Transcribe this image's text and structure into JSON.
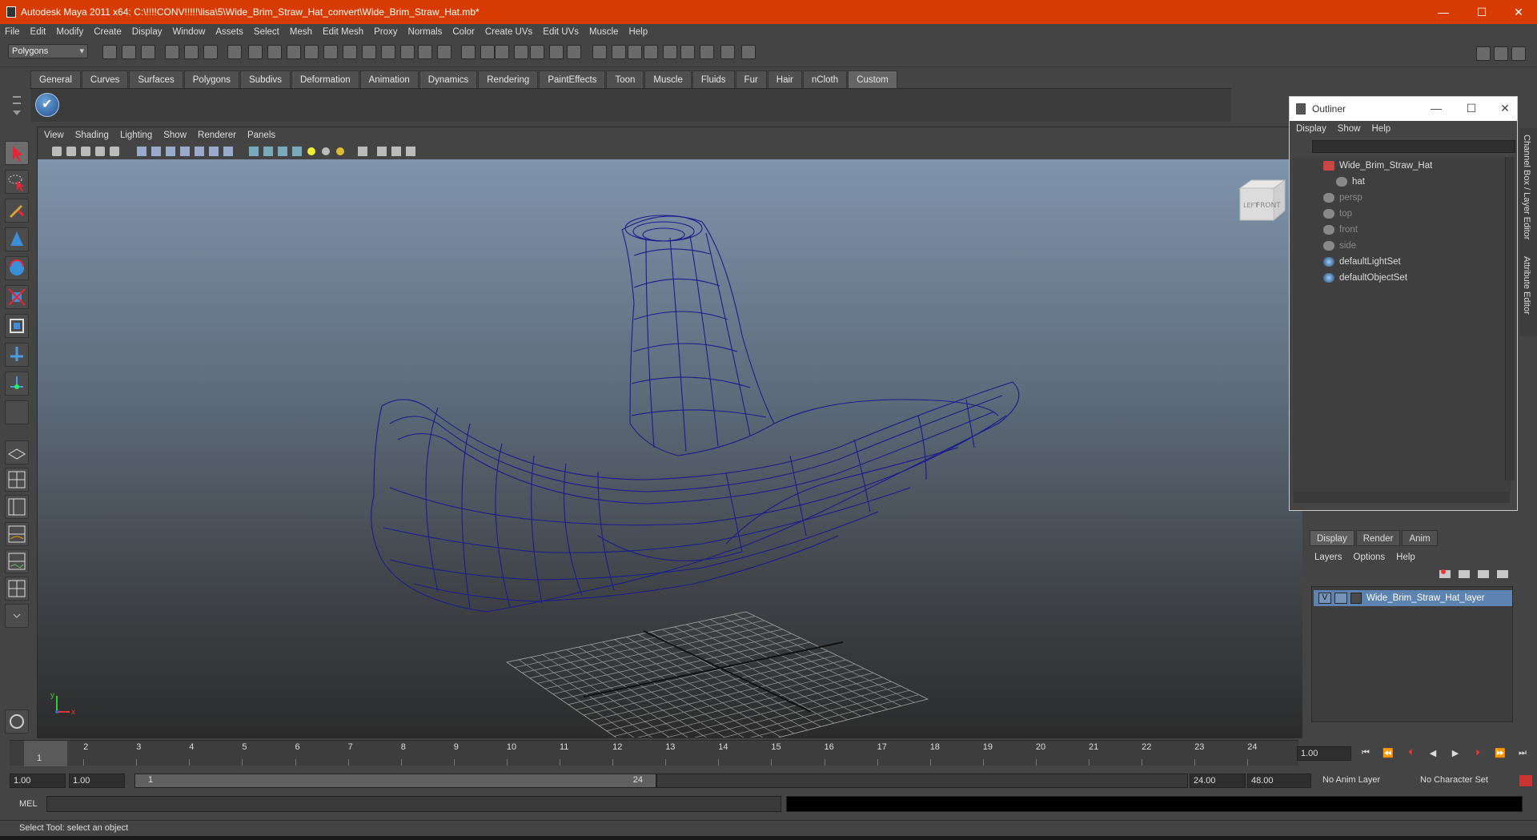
{
  "window": {
    "title": "Autodesk Maya 2011 x64: C:\\!!!!CONV!!!!!\\lisa\\5\\Wide_Brim_Straw_Hat_convert\\Wide_Brim_Straw_Hat.mb*",
    "minimize": "—",
    "maximize": "☐",
    "close": "✕"
  },
  "menubar": [
    "File",
    "Edit",
    "Modify",
    "Create",
    "Display",
    "Window",
    "Assets",
    "Select",
    "Mesh",
    "Edit Mesh",
    "Proxy",
    "Normals",
    "Color",
    "Create UVs",
    "Edit UVs",
    "Muscle",
    "Help"
  ],
  "mode_selector": "Polygons",
  "shelf_tabs": [
    "General",
    "Curves",
    "Surfaces",
    "Polygons",
    "Subdivs",
    "Deformation",
    "Animation",
    "Dynamics",
    "Rendering",
    "PaintEffects",
    "Toon",
    "Muscle",
    "Fluids",
    "Fur",
    "Hair",
    "nCloth",
    "Custom"
  ],
  "active_shelf": "Custom",
  "panel_menu": [
    "View",
    "Shading",
    "Lighting",
    "Show",
    "Renderer",
    "Panels"
  ],
  "viewcube": {
    "left": "LEFT",
    "front": "FRONT"
  },
  "axis": {
    "x": "x",
    "y": "y"
  },
  "outliner": {
    "title": "Outliner",
    "menu": [
      "Display",
      "Show",
      "Help"
    ],
    "items": [
      {
        "label": "Wide_Brim_Straw_Hat",
        "icon": "transform-icon",
        "dim": false
      },
      {
        "label": "hat",
        "icon": "mesh-icon",
        "dim": false
      },
      {
        "label": "persp",
        "icon": "camera-icon",
        "dim": true
      },
      {
        "label": "top",
        "icon": "camera-icon",
        "dim": true
      },
      {
        "label": "front",
        "icon": "camera-icon",
        "dim": true
      },
      {
        "label": "side",
        "icon": "camera-icon",
        "dim": true
      },
      {
        "label": "defaultLightSet",
        "icon": "set-icon",
        "dim": false
      },
      {
        "label": "defaultObjectSet",
        "icon": "set-icon",
        "dim": false
      }
    ]
  },
  "side_tabs": [
    "Channel Box / Layer Editor",
    "Attribute Editor"
  ],
  "layer_editor": {
    "tabs": [
      "Display",
      "Render",
      "Anim"
    ],
    "active_tab": "Display",
    "menu": [
      "Layers",
      "Options",
      "Help"
    ],
    "layer": {
      "visible": "V",
      "name": "Wide_Brim_Straw_Hat_layer"
    }
  },
  "timeline": {
    "ticks": [
      "1",
      "2",
      "3",
      "4",
      "5",
      "6",
      "7",
      "8",
      "9",
      "10",
      "11",
      "12",
      "13",
      "14",
      "15",
      "16",
      "17",
      "18",
      "19",
      "20",
      "21",
      "22",
      "23",
      "24"
    ],
    "current_marker": "1",
    "current_time": "1.00"
  },
  "range": {
    "start": "1.00",
    "playback_start": "1.00",
    "slider_start": "1",
    "slider_end": "24",
    "playback_end": "24.00",
    "end": "48.00",
    "anim_layer": "No Anim Layer",
    "character_set": "No Character Set"
  },
  "command": {
    "label": "MEL"
  },
  "help_line": "Select Tool: select an object",
  "colors": {
    "title_bar": "#d83b01",
    "wire": "#1c1c8c",
    "layer_row": "#5d83b0",
    "grid": "#9a9a9a"
  }
}
